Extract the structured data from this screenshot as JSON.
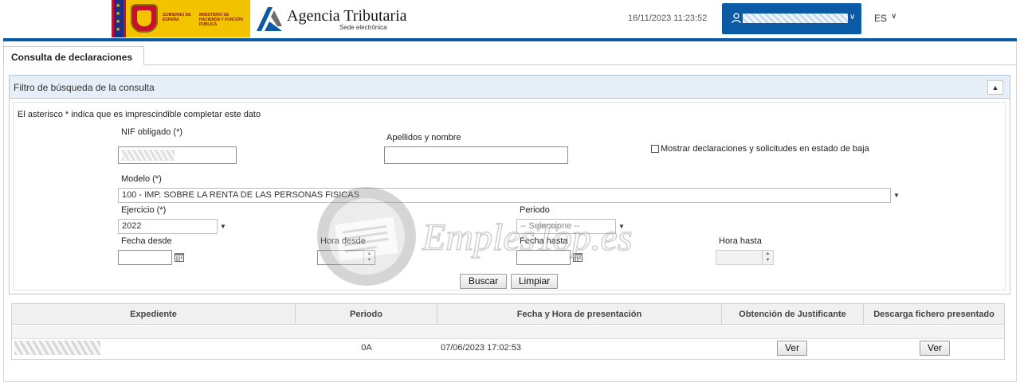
{
  "header": {
    "gov_text_1": "Gobierno de España",
    "gov_text_2": "Ministerio de Hacienda y Función Pública",
    "agency_title": "Agencia Tributaria",
    "agency_subtitle": "Sede electrónica",
    "datetime": "16/11/2023 11:23:52",
    "user_menu_icon": "chevron-down-icon",
    "language": "ES"
  },
  "tabs": [
    {
      "label": "Consulta de declaraciones",
      "active": true
    }
  ],
  "filter": {
    "title": "Filtro de búsqueda de la consulta",
    "note": "El asterisco * indica que es imprescindible completar este dato",
    "nif_label": "NIF obligado (*)",
    "nif_value": "",
    "name_label": "Apellidos y nombre",
    "name_value": "",
    "show_baja_label": "Mostrar declaraciones y solicitudes en estado de baja",
    "show_baja_checked": false,
    "modelo_label": "Modelo (*)",
    "modelo_value": "100 - IMP. SOBRE LA RENTA DE LAS PERSONAS FISICAS",
    "ejercicio_label": "Ejercicio (*)",
    "ejercicio_value": "2022",
    "periodo_label": "Periodo",
    "periodo_value": "-- Seleccione --",
    "fecha_desde_label": "Fecha desde",
    "hora_desde_label": "Hora desde",
    "fecha_hasta_label": "Fecha hasta",
    "hora_hasta_label": "Hora hasta",
    "buscar_label": "Buscar",
    "limpiar_label": "Limpiar"
  },
  "results": {
    "columns": [
      "Expediente",
      "Periodo",
      "Fecha y Hora de presentación",
      "Obtención de Justificante",
      "Descarga fichero presentado"
    ],
    "rows": [
      {
        "expediente": "",
        "periodo": "0A",
        "fecha": "07/06/2023 17:02:53",
        "justificante": "Ver",
        "descarga": "Ver"
      }
    ]
  },
  "watermark": {
    "text": "EmplesTop.es"
  },
  "colors": {
    "brand_blue": "#0b5aa6",
    "panel_header": "#e6eef7",
    "gov_yellow": "#f4c300",
    "gov_red": "#c8102e"
  }
}
